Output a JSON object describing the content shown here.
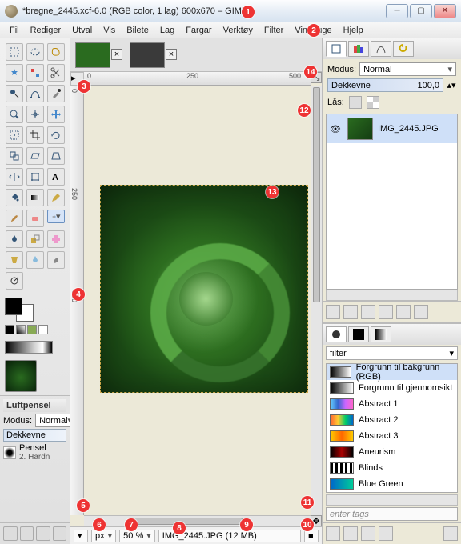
{
  "window": {
    "title": "*bregne_2445.xcf-6.0 (RGB color, 1 lag) 600x670 – GIMP"
  },
  "menu": {
    "items": [
      "Fil",
      "Rediger",
      "Utval",
      "Vis",
      "Bilete",
      "Lag",
      "Fargar",
      "Verktøy",
      "Filter",
      "Vindauge",
      "Hjelp"
    ]
  },
  "ruler": {
    "h_ticks": [
      "0",
      "250",
      "500"
    ],
    "v_ticks": [
      "0",
      "250",
      "500"
    ]
  },
  "status": {
    "unit": "px",
    "zoom": "50 %",
    "filename": "IMG_2445.JPG",
    "size": "12 MB"
  },
  "layers_panel": {
    "mode_label": "Modus:",
    "mode_value": "Normal",
    "opacity_label": "Dekkevne",
    "opacity_value": "100,0",
    "lock_label": "Lås:",
    "layer_name": "IMG_2445.JPG"
  },
  "tool_options": {
    "title": "Luftpensel",
    "mode_label": "Modus:",
    "mode_value": "Normal",
    "opacity_label": "Dekkevne",
    "brush_label": "Pensel",
    "brush_value": "2. Hardn"
  },
  "gradients": {
    "filter_label": "filter",
    "items": [
      {
        "name": "Forgrunn til bakgrunn (RGB)",
        "css": "linear-gradient(90deg,#000,#fff)"
      },
      {
        "name": "Forgrunn til gjennomsikt",
        "css": "linear-gradient(90deg,#000,rgba(0,0,0,0))"
      },
      {
        "name": "Abstract 1",
        "css": "linear-gradient(90deg,#6cf,#36c,#c6f,#f6c)"
      },
      {
        "name": "Abstract 2",
        "css": "linear-gradient(90deg,#f63,#fc3,#0c6,#06c)"
      },
      {
        "name": "Abstract 3",
        "css": "linear-gradient(90deg,#fc0,#f60,#fc0)"
      },
      {
        "name": "Aneurism",
        "css": "linear-gradient(90deg,#000,#a00,#000)"
      },
      {
        "name": "Blinds",
        "css": "repeating-linear-gradient(90deg,#000 0 3px,#fff 3px 6px)"
      },
      {
        "name": "Blue Green",
        "css": "linear-gradient(90deg,#06c,#0c9)"
      }
    ],
    "tags_placeholder": "enter tags"
  },
  "annotations": {
    "1": "titlebar",
    "2": "menubar",
    "3": "ruler-origin",
    "4": "ruler-vertical",
    "5": "hscroll",
    "6": "quicknav-btn",
    "7": "unit-selector",
    "8": "zoom-field",
    "9": "status-area",
    "10": "nav-corner",
    "11": "hscroll-end",
    "12": "vscroll",
    "13": "image-canvas",
    "14": "zoom-fit"
  }
}
